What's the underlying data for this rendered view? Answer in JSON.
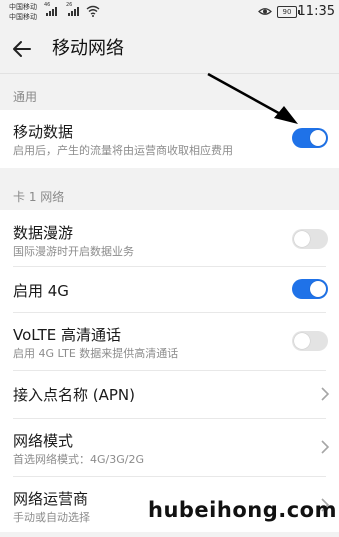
{
  "status_bar": {
    "carrier1": "中国移动",
    "carrier2": "中国移动",
    "sig1_tag": "46",
    "sig2_tag": "26",
    "battery": "90",
    "time": "11:35"
  },
  "header": {
    "title": "移动网络"
  },
  "sections": [
    {
      "title": "通用"
    },
    {
      "title": "卡 1 网络"
    }
  ],
  "items": {
    "mobile_data": {
      "title": "移动数据",
      "subtitle": "启用后，产生的流量将由运营商收取相应费用",
      "enabled": true
    },
    "roaming": {
      "title": "数据漫游",
      "subtitle": "国际漫游时开启数据业务",
      "enabled": false
    },
    "enable_4g": {
      "title": "启用 4G",
      "enabled": true
    },
    "volte": {
      "title": "VoLTE 高清通话",
      "subtitle": "启用 4G LTE 数据来提供高清通话",
      "enabled": false
    },
    "apn": {
      "title": "接入点名称 (APN)"
    },
    "network_mode": {
      "title": "网络模式",
      "subtitle": "首选网络模式：4G/3G/2G"
    },
    "operator": {
      "title": "网络运营商",
      "subtitle": "手动或自动选择"
    }
  },
  "colors": {
    "accent": "#1f72e8",
    "toggle_off": "#e3e3e3"
  },
  "watermark": "hubeihong.com"
}
